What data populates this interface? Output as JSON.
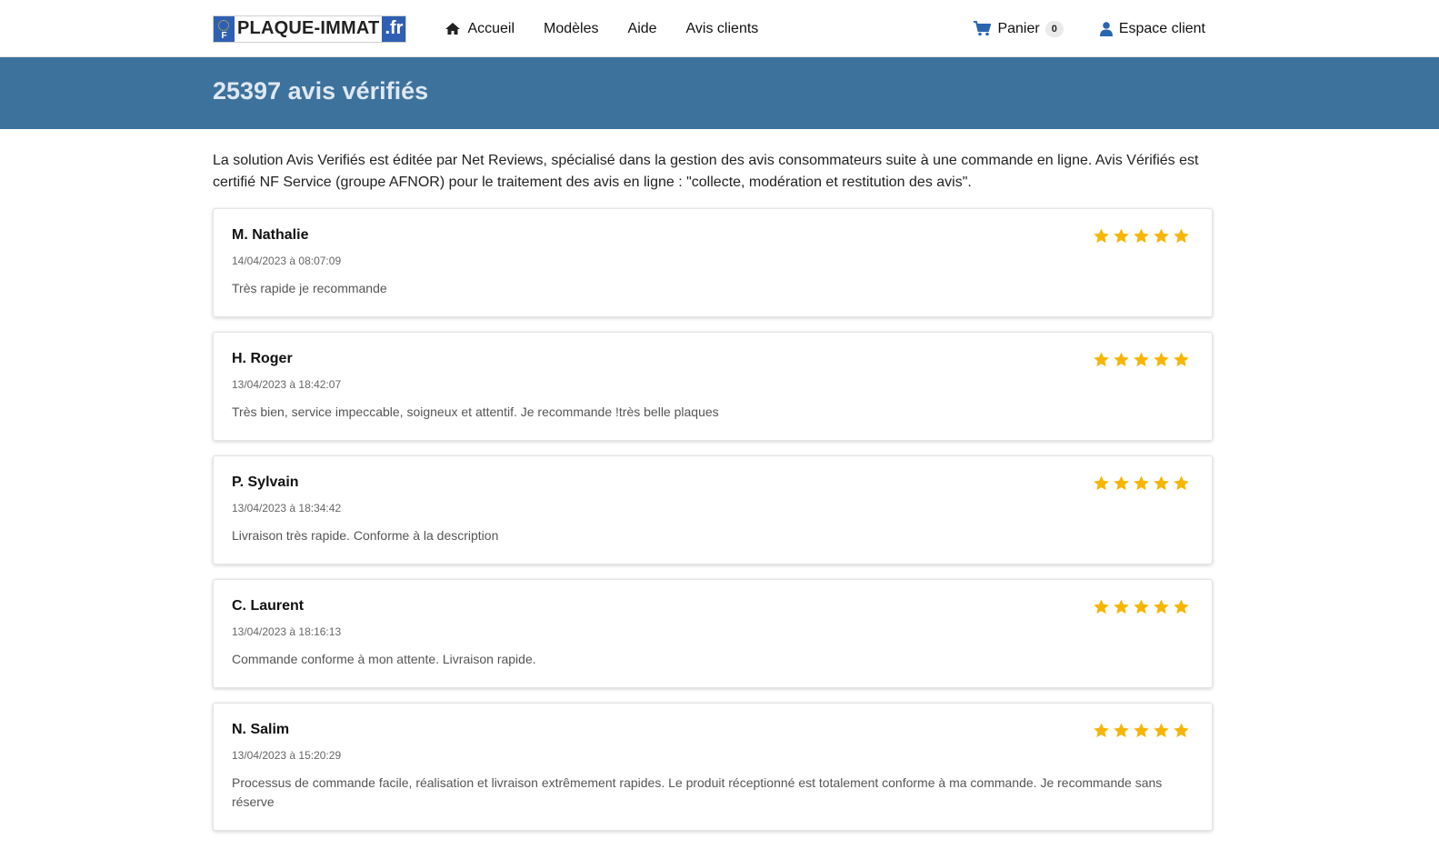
{
  "brand": {
    "name": "PLAQUE-IMMAT",
    "tld": ".fr",
    "plate_letter": "F"
  },
  "nav": {
    "links": [
      {
        "label": "Accueil",
        "icon": "home-icon"
      },
      {
        "label": "Modèles"
      },
      {
        "label": "Aide"
      },
      {
        "label": "Avis clients"
      }
    ],
    "cart": {
      "label": "Panier",
      "count": "0",
      "icon": "cart-icon"
    },
    "account": {
      "label": "Espace client",
      "icon": "user-icon"
    }
  },
  "hero": {
    "title": "25397 avis vérifiés"
  },
  "intro": "La solution Avis Verifiés est éditée par Net Reviews, spécialisé dans la gestion des avis consommateurs suite à une commande en ligne. Avis Vérifiés est certifié NF Service (groupe AFNOR) pour le traitement des avis en ligne : \"collecte, modération et restitution des avis\".",
  "colors": {
    "accent": "#3d729d",
    "star": "#f7b500",
    "plate_blue": "#2f5fb3"
  },
  "reviews": [
    {
      "name": "M. Nathalie",
      "date": "14/04/2023 à 08:07:09",
      "text": "Très rapide je recommande",
      "rating": 5
    },
    {
      "name": "H. Roger",
      "date": "13/04/2023 à 18:42:07",
      "text": "Très bien, service impeccable, soigneux et attentif. Je recommande !très belle plaques",
      "rating": 5
    },
    {
      "name": "P. Sylvain",
      "date": "13/04/2023 à 18:34:42",
      "text": "Livraison très rapide. Conforme à la description",
      "rating": 5
    },
    {
      "name": "C. Laurent",
      "date": "13/04/2023 à 18:16:13",
      "text": "Commande conforme à mon attente. Livraison rapide.",
      "rating": 5
    },
    {
      "name": "N. Salim",
      "date": "13/04/2023 à 15:20:29",
      "text": "Processus de commande facile, réalisation et livraison extrêmement rapides. Le produit réceptionné est totalement conforme à ma commande. Je recommande sans réserve",
      "rating": 5
    }
  ]
}
